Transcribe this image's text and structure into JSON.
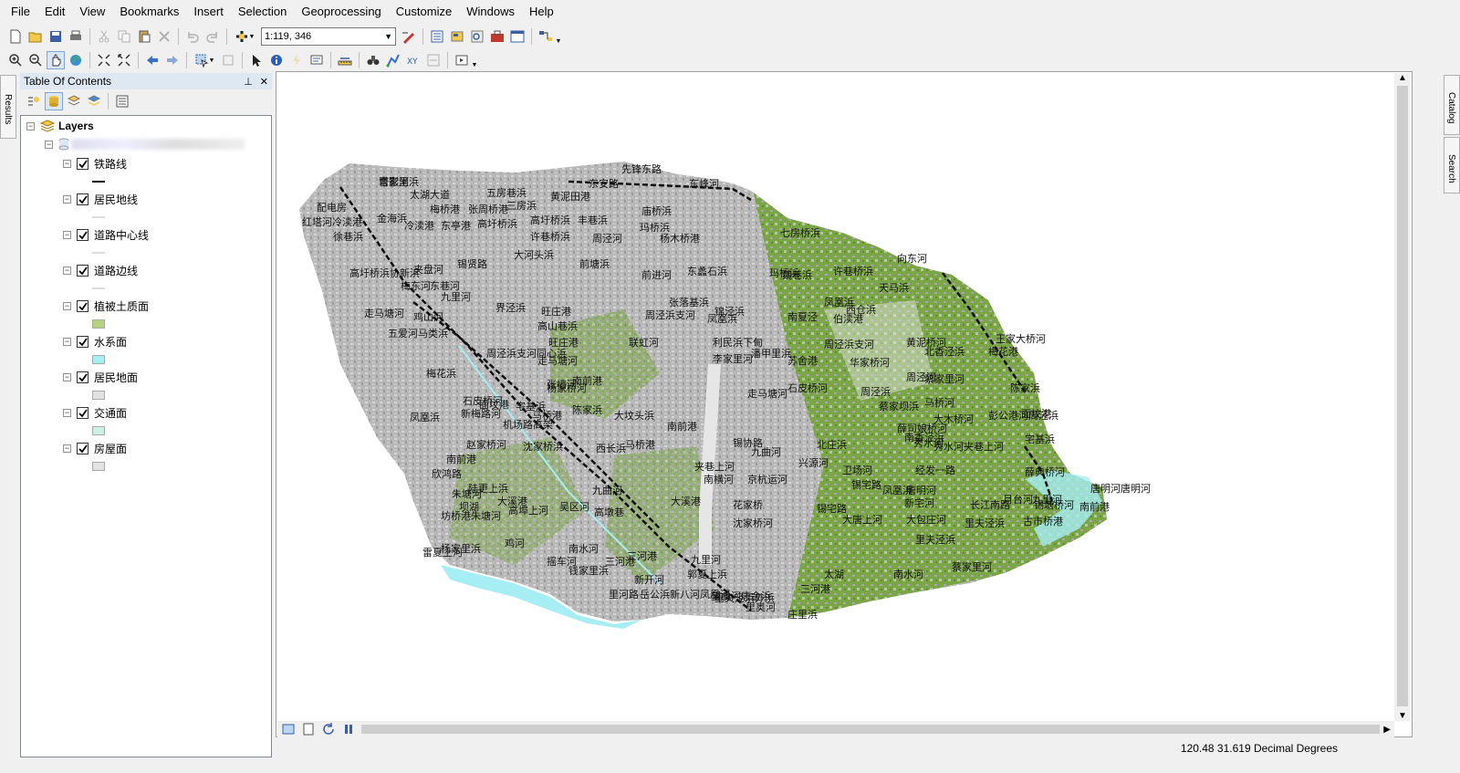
{
  "menubar": {
    "items": [
      "File",
      "Edit",
      "View",
      "Bookmarks",
      "Insert",
      "Selection",
      "Geoprocessing",
      "Customize",
      "Windows",
      "Help"
    ]
  },
  "toolbar": {
    "scale_value": "1:119, 346"
  },
  "side_tabs": {
    "results": "Results",
    "catalog": "Catalog",
    "search": "Search"
  },
  "toc": {
    "title": "Table Of Contents",
    "pin_icon": "pin-icon",
    "close_icon": "close-icon",
    "root_label": "Layers",
    "layers": [
      {
        "name": "铁路线",
        "checked": true,
        "symbol": "line-dash"
      },
      {
        "name": "居民地线",
        "checked": true,
        "symbol": "line"
      },
      {
        "name": "道路中心线",
        "checked": true,
        "symbol": "line"
      },
      {
        "name": "道路边线",
        "checked": true,
        "symbol": "line"
      },
      {
        "name": "植被土质面",
        "checked": true,
        "symbol": "fill",
        "color": "#b5d37f"
      },
      {
        "name": "水系面",
        "checked": true,
        "symbol": "fill",
        "color": "#a6eef3"
      },
      {
        "name": "居民地面",
        "checked": true,
        "symbol": "fill",
        "color": "#e1e1e1"
      },
      {
        "name": "交通面",
        "checked": true,
        "symbol": "fill",
        "color": "#c9f2e6"
      },
      {
        "name": "房屋面",
        "checked": true,
        "symbol": "fill",
        "color": "#e3e3e3"
      }
    ]
  },
  "map": {
    "colors": {
      "urban": "#b0b0b0",
      "vegetation": "#6c9a3a",
      "water": "#a6eef3",
      "rail": "#111111"
    },
    "labels": [
      "塔影河",
      "先锋东路",
      "东安路",
      "东峰河",
      "配电房",
      "太湖大道",
      "五房巷浜",
      "黄泥田港",
      "红塔河冷渎港",
      "金海浜",
      "梅桥港",
      "张周桥港",
      "三房浜",
      "高圩桥浜",
      "丰巷浜",
      "庙桥浜",
      "徐巷浜",
      "冷渎港",
      "东亭港",
      "高圩桥浜",
      "许巷桥浜",
      "周泾河",
      "杨木桥港",
      "玛桥浜",
      "七房桥浜",
      "高圩桥浜协新浜",
      "夹盘河",
      "锡贤路",
      "大河头浜",
      "前塘浜",
      "前进河",
      "东蠡石浜",
      "玛桥浜",
      "许巷桥浜",
      "向东河",
      "梅东河",
      "东巷河",
      "九里河",
      "界泾浜",
      "旺庄港",
      "张落基浜",
      "锦泾浜",
      "魏巷浜",
      "凤凰浜",
      "天马浜",
      "西仓浜",
      "走马塘河",
      "鸡山河",
      "高山巷浜",
      "旺庄港",
      "周泾浜支河",
      "凤凰浜",
      "南夏泾",
      "伯渎港",
      "黄泥桥河",
      "王家大桥河",
      "五爱河马类浜",
      "周泾浜支河同心浜",
      "走马塘河",
      "联虹河",
      "利民浜下甸",
      "潘甲里浜",
      "周泾浜支河",
      "北香泾浜",
      "梅花浜",
      "张墙河",
      "李家里河",
      "苏舍港",
      "华家桥河",
      "周泾河",
      "梅花港",
      "陈家浜",
      "杨家桥河",
      "南前港",
      "石皮桥河",
      "周泾浜",
      "蔡家坝浜",
      "马桥河",
      "蔡家里河",
      "石皮桥河",
      "面坟港",
      "宅基浜",
      "陈家浜",
      "走马塘河",
      "大木桥河",
      "彭公港河",
      "面坟港",
      "周泾浜",
      "凤凰浜",
      "新梅路河",
      "马桥港",
      "大坟头浜",
      "南前港",
      "薛司娘桥河",
      "南香泾浜",
      "机场路高架",
      "马桥港",
      "锡协路",
      "九曲河",
      "北庄浜",
      "秀水河",
      "秀水河夹巷上河",
      "宅基浜",
      "赵家桥河",
      "南前港",
      "沈家桥浜",
      "西长浜",
      "夹巷上河",
      "兴源河",
      "卫场河",
      "经发一路",
      "薛典桥河",
      "欣鸿路",
      "九曲河",
      "南横河",
      "京杭运河",
      "凤凰浜",
      "锡宅路",
      "唐明河",
      "唐明河唐明河",
      "九里河",
      "朱塘河",
      "陆更上浜",
      "高埠上河",
      "大溪港",
      "花家桥",
      "锡宅路",
      "新宅河",
      "月台河",
      "锡塘桥河",
      "南前港",
      "坊桥港朱塘河",
      "坝湖",
      "大溪港",
      "吴区河",
      "高墩巷",
      "沈家桥河",
      "大唐上河",
      "大包庄河",
      "里夫泾浜",
      "古市桥港",
      "雷夏上河",
      "杨家里浜",
      "鸡河",
      "南水河",
      "三河港",
      "九里河",
      "里夫泾浜",
      "长江南路",
      "钱家里浜",
      "新开河",
      "郭夏上浜",
      "太湖",
      "南水河",
      "三河港",
      "摇车河",
      "里河路",
      "岳公浜新八河凤凰河",
      "里夫泾浜外浜",
      "蔡家里河",
      "望虞河唐金浜",
      "三河港",
      "里奥河",
      "庄里浜",
      "曹家里浜"
    ]
  },
  "status": {
    "coords": "120.48  31.619 Decimal Degrees"
  }
}
